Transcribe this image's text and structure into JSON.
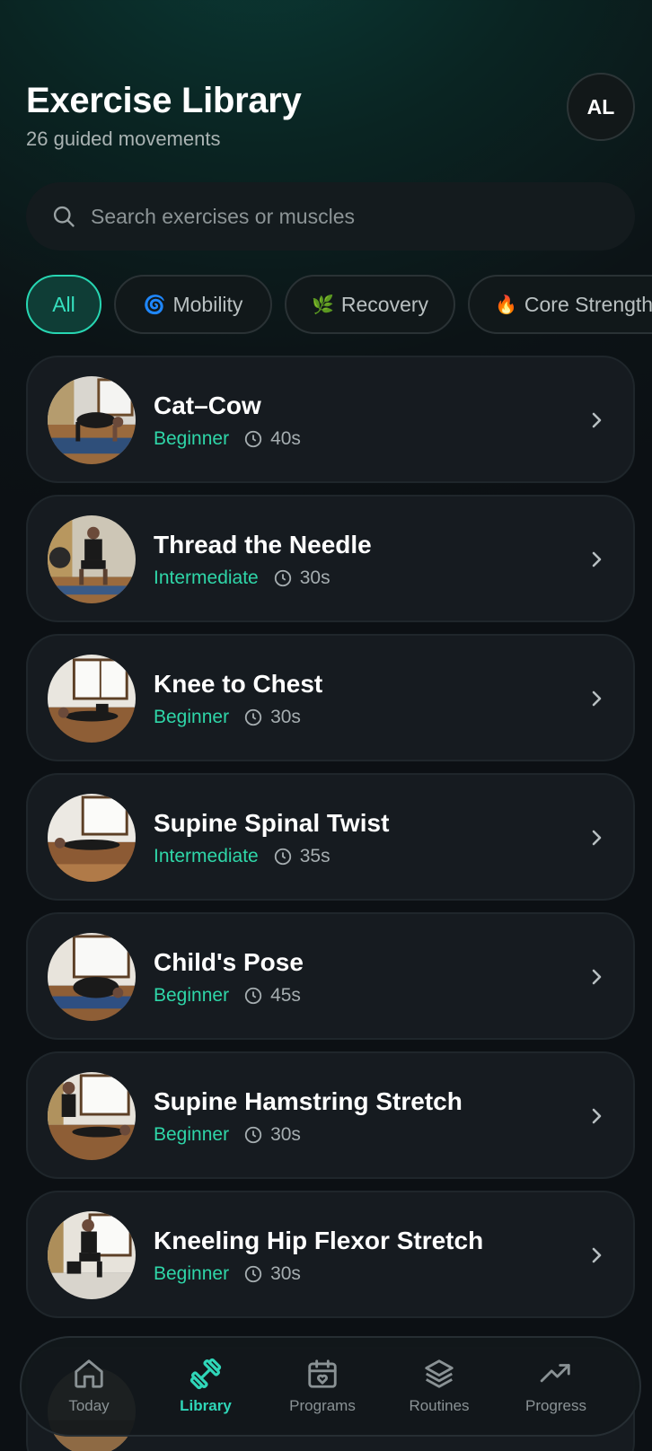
{
  "header": {
    "title": "Exercise Library",
    "subtitle": "26 guided movements",
    "avatar_initials": "AL"
  },
  "search": {
    "placeholder": "Search exercises or muscles",
    "icon": "search-icon"
  },
  "filters": [
    {
      "label": "All",
      "emoji": "",
      "active": true
    },
    {
      "label": "Mobility",
      "emoji": "🌀",
      "active": false
    },
    {
      "label": "Recovery",
      "emoji": "🌿",
      "active": false
    },
    {
      "label": "Core Strength",
      "emoji": "🔥",
      "active": false
    }
  ],
  "exercises": [
    {
      "name": "Cat–Cow",
      "level": "Beginner",
      "duration": "40s"
    },
    {
      "name": "Thread the Needle",
      "level": "Intermediate",
      "duration": "30s"
    },
    {
      "name": "Knee to Chest",
      "level": "Beginner",
      "duration": "30s"
    },
    {
      "name": "Supine Spinal Twist",
      "level": "Intermediate",
      "duration": "35s"
    },
    {
      "name": "Child's Pose",
      "level": "Beginner",
      "duration": "45s"
    },
    {
      "name": "Supine Hamstring Stretch",
      "level": "Beginner",
      "duration": "30s"
    },
    {
      "name": "Kneeling Hip Flexor Stretch",
      "level": "Beginner",
      "duration": "30s"
    }
  ],
  "nav": [
    {
      "label": "Today",
      "icon": "home-icon",
      "active": false
    },
    {
      "label": "Library",
      "icon": "dumbbell-icon",
      "active": true
    },
    {
      "label": "Programs",
      "icon": "calendar-heart-icon",
      "active": false
    },
    {
      "label": "Routines",
      "icon": "layers-icon",
      "active": false
    },
    {
      "label": "Progress",
      "icon": "trend-up-icon",
      "active": false
    }
  ],
  "colors": {
    "accent": "#2fd6b8",
    "level": "#2fd6a8",
    "card_bg": "#161b20",
    "background": "#0c1014"
  }
}
